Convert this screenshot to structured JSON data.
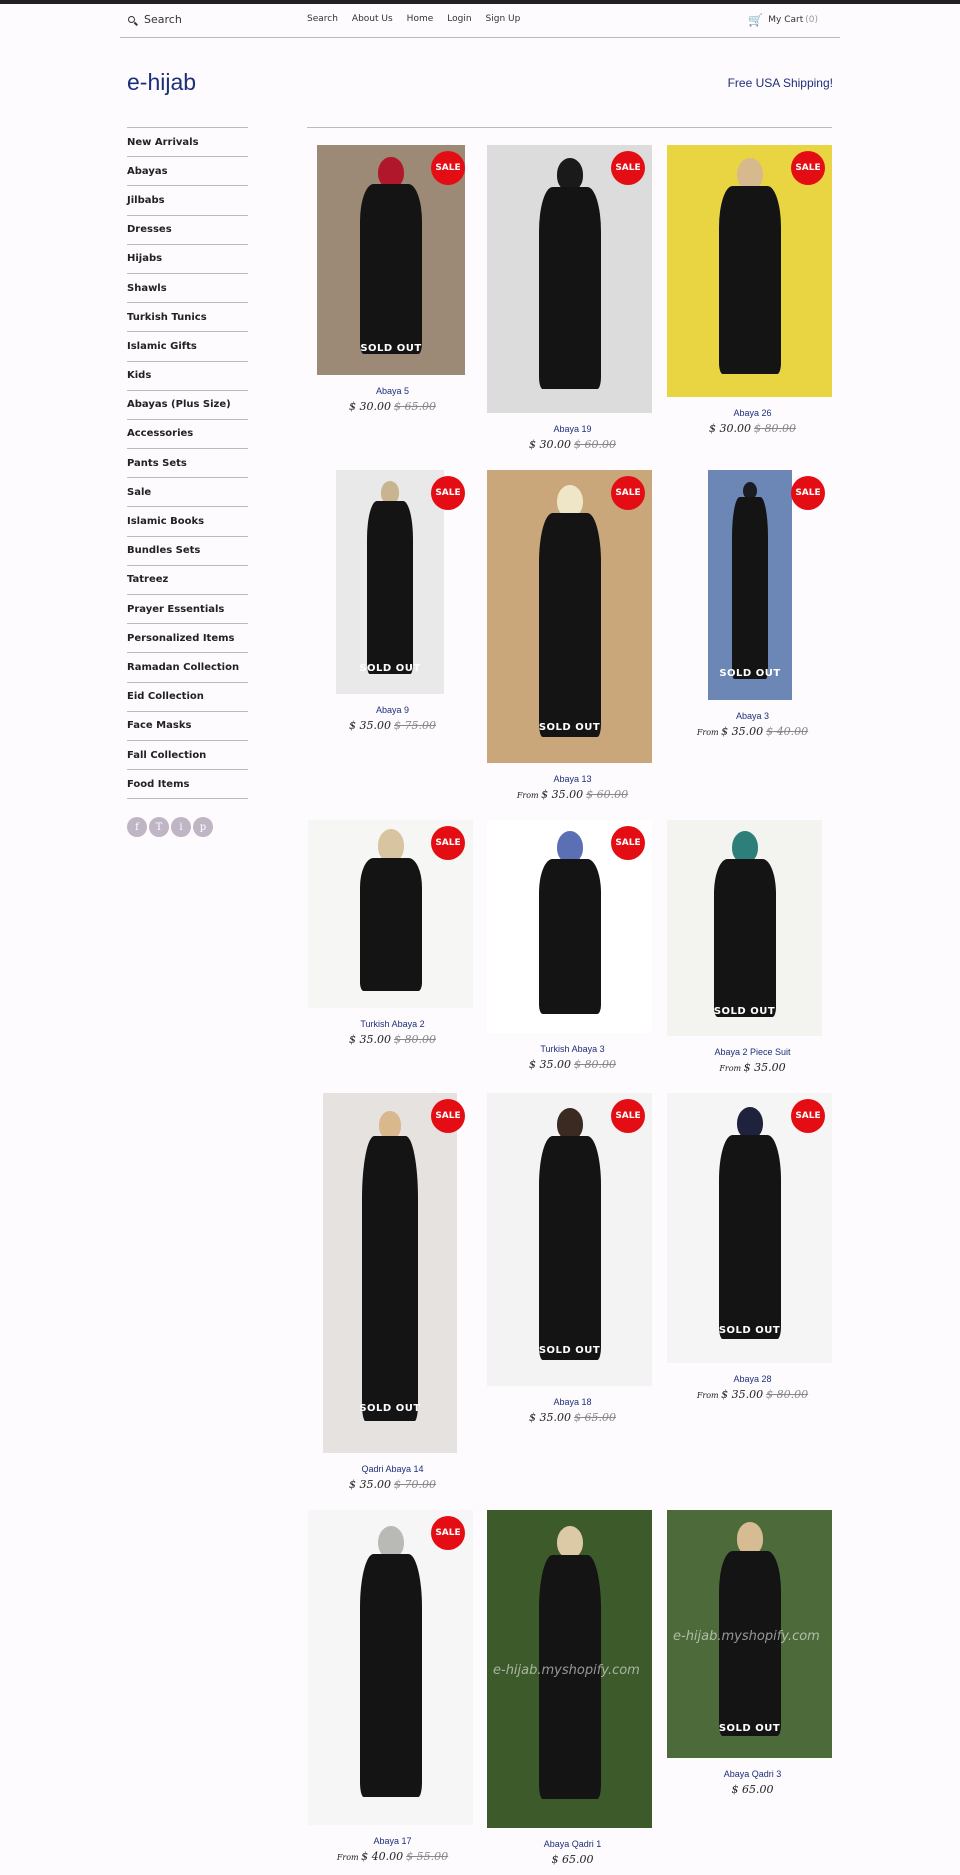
{
  "header": {
    "search_label": "Search",
    "nav": [
      "Search",
      "About Us",
      "Home",
      "Login",
      "Sign Up"
    ],
    "cart_label": "My Cart",
    "cart_count": "(0)"
  },
  "brand": {
    "logo": "e-hijab",
    "shipping": "Free USA Shipping!",
    "accent": "#1e2f7a",
    "sale_color": "#e40d13"
  },
  "sidebar": {
    "items": [
      "New Arrivals",
      "Abayas",
      "Jilbabs",
      "Dresses",
      "Hijabs",
      "Shawls",
      "Turkish Tunics",
      "Islamic Gifts",
      "Kids",
      "Abayas (Plus Size)",
      "Accessories",
      "Pants Sets",
      "Sale",
      "Islamic Books",
      "Bundles Sets",
      "Tatreez",
      "Prayer Essentials",
      "Personalized Items",
      "Ramadan Collection",
      "Eid Collection",
      "Face Masks",
      "Fall Collection",
      "Food Items"
    ]
  },
  "social": [
    "f",
    "T",
    "i",
    "p"
  ],
  "labels": {
    "sale": "SALE",
    "sold_out": "SOLD OUT",
    "from": "From"
  },
  "products": [
    {
      "name": "Abaya 5",
      "price": "$ 30.00",
      "original": "$ 65.00",
      "from": false,
      "sale": true,
      "sold_out": true,
      "bg": "#9c8a76",
      "hijab": "#b0172a"
    },
    {
      "name": "Abaya 19",
      "price": "$ 30.00",
      "original": "$ 60.00",
      "from": false,
      "sale": true,
      "sold_out": false,
      "bg": "#dcdcdc",
      "hijab": "#1a1a1a"
    },
    {
      "name": "Abaya 26",
      "price": "$ 30.00",
      "original": "$ 80.00",
      "from": false,
      "sale": true,
      "sold_out": false,
      "bg": "#e8d541",
      "hijab": "#d6b98c"
    },
    {
      "name": "Abaya 9",
      "price": "$ 35.00",
      "original": "$ 75.00",
      "from": false,
      "sale": true,
      "sold_out": true,
      "bg": "#e9e9ea",
      "hijab": "#c8b48e"
    },
    {
      "name": "Abaya 13",
      "price": "$ 35.00",
      "original": "$ 60.00",
      "from": true,
      "sale": true,
      "sold_out": true,
      "bg": "#c9a77a",
      "hijab": "#efe6c8"
    },
    {
      "name": "Abaya 3",
      "price": "$ 35.00",
      "original": "$ 40.00",
      "from": true,
      "sale": true,
      "sold_out": true,
      "bg": "#6c86b6",
      "hijab": "#1b1b22"
    },
    {
      "name": "Turkish Abaya 2",
      "price": "$ 35.00",
      "original": "$ 80.00",
      "from": false,
      "sale": true,
      "sold_out": false,
      "bg": "#f6f7f4",
      "hijab": "#d9c4a2"
    },
    {
      "name": "Turkish Abaya 3",
      "price": "$ 35.00",
      "original": "$ 80.00",
      "from": false,
      "sale": true,
      "sold_out": false,
      "bg": "#ffffff",
      "hijab": "#5a6fb4"
    },
    {
      "name": "Abaya 2 Piece Suit",
      "price": "$ 35.00",
      "original": "",
      "from": true,
      "sale": false,
      "sold_out": true,
      "bg": "#f3f4f0",
      "hijab": "#2e7f79"
    },
    {
      "name": "Qadri Abaya 14",
      "price": "$ 35.00",
      "original": "$ 70.00",
      "from": false,
      "sale": true,
      "sold_out": true,
      "bg": "#e6e2e0",
      "hijab": "#d8b88c"
    },
    {
      "name": "Abaya 18",
      "price": "$ 35.00",
      "original": "$ 65.00",
      "from": false,
      "sale": true,
      "sold_out": true,
      "bg": "#f4f3f3",
      "hijab": "#3a2a22"
    },
    {
      "name": "Abaya 28",
      "price": "$ 35.00",
      "original": "$ 80.00",
      "from": true,
      "sale": true,
      "sold_out": true,
      "bg": "#f6f5f5",
      "hijab": "#1e223d"
    },
    {
      "name": "Abaya 17",
      "price": "$ 40.00",
      "original": "$ 55.00",
      "from": true,
      "sale": true,
      "sold_out": false,
      "bg": "#f6f6f6",
      "hijab": "#b9b9b5"
    },
    {
      "name": "Abaya Qadri 1",
      "price": "$ 65.00",
      "original": "",
      "from": false,
      "sale": false,
      "sold_out": false,
      "bg": "#3d5a2a",
      "hijab": "#dcc9a6",
      "watermark": "e-hijab.myshopify.com"
    },
    {
      "name": "Abaya Qadri 3",
      "price": "$ 65.00",
      "original": "",
      "from": false,
      "sale": false,
      "sold_out": true,
      "bg": "#4c6a3a",
      "hijab": "#d6bb93",
      "watermark": "e-hijab.myshopify.com"
    }
  ]
}
